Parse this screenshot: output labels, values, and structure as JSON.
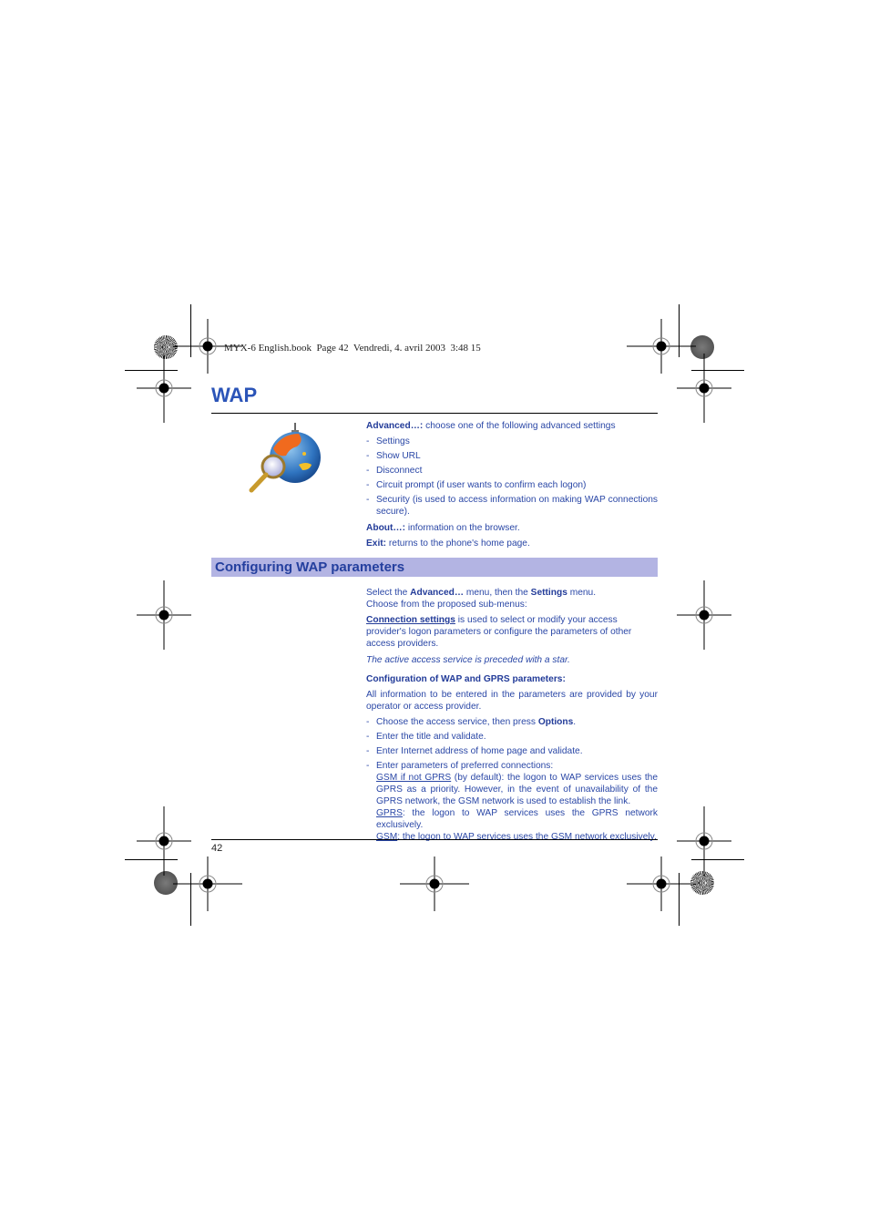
{
  "print_header": "MYX-6 English.book  Page 42  Vendredi, 4. avril 2003  3:48 15",
  "page_title": "WAP",
  "illustration": "globe-with-magnifier-icon",
  "advanced": {
    "label": "Advanced…:",
    "text": " choose one of the following advanced settings",
    "items": [
      "Settings",
      "Show URL",
      "Disconnect",
      "Circuit prompt (if user wants to confirm each logon)",
      "Security (is used to access information on making WAP connections secure)."
    ]
  },
  "about": {
    "label": "About…:",
    "text": " information on the browser."
  },
  "exit": {
    "label": "Exit:",
    "text": " returns to the phone's home page."
  },
  "section": {
    "title": "Configuring WAP parameters",
    "intro": {
      "p1_a": "Select the ",
      "p1_b": "Advanced…",
      "p1_c": " menu, then the ",
      "p1_d": "Settings",
      "p1_e": " menu.",
      "p2": "Choose from the proposed sub-menus:"
    },
    "connection": {
      "label": "Connection settings",
      "text": " is used to select or modify your access provider's logon parameters or configure the parameters of other access providers."
    },
    "note": "The active access service is preceded with a star.",
    "config_heading": "Configuration of WAP and GPRS parameters:",
    "config_text": "All information to be entered in the parameters are provided by your operator or access provider.",
    "steps": {
      "s1_a": "Choose the access service, then press ",
      "s1_b": "Options",
      "s1_c": ".",
      "s2": "Enter the title and validate.",
      "s3": "Enter Internet address of home page and validate.",
      "s4": "Enter parameters of preferred connections:"
    },
    "options": [
      {
        "label": "GSM if not GPRS",
        "text": " (by default): the logon to WAP services uses the GPRS as a priority. However, in the event of unavailability of the GPRS network, the GSM network is used to establish the link."
      },
      {
        "label": "GPRS",
        "text": ": the logon to WAP services uses the GPRS network exclusively."
      },
      {
        "label": "GSM",
        "text": ": the logon to WAP services uses the GSM network exclusively."
      }
    ]
  },
  "page_number": "42"
}
